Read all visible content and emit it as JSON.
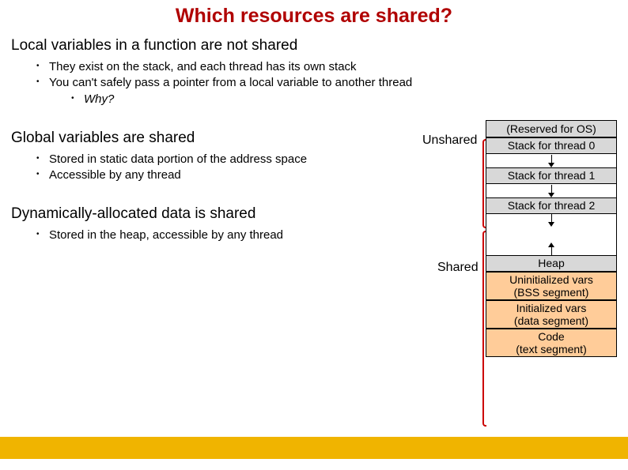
{
  "title": "Which resources are shared?",
  "sections": {
    "local": {
      "heading": "Local variables in a function are not shared",
      "b1a": "They exist on the stack, and each thread has its own stack",
      "b1b": "You can't safely pass a pointer from a local variable to another thread",
      "b2a": "Why?"
    },
    "global": {
      "heading": "Global variables are shared",
      "b1a": "Stored in static data portion of the address space",
      "b1b": "Accessible by any thread"
    },
    "dynamic": {
      "heading": "Dynamically-allocated data is shared",
      "b1a": "Stored in the heap, accessible by any thread"
    }
  },
  "diagram": {
    "os": "(Reserved for OS)",
    "stack0": "Stack for thread 0",
    "stack1": "Stack for thread 1",
    "stack2": "Stack for thread 2",
    "heap": "Heap",
    "bss": "Uninitialized vars\n(BSS segment)",
    "data": "Initialized vars\n(data segment)",
    "code": "Code\n(text segment)"
  },
  "labels": {
    "unshared": "Unshared",
    "shared": "Shared"
  }
}
